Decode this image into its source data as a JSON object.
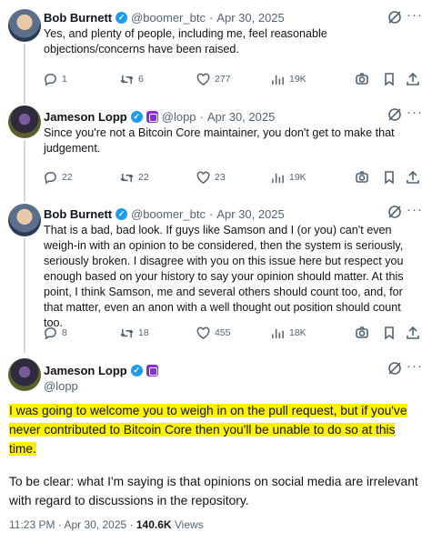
{
  "replies": [
    {
      "name": "Bob Burnett",
      "handle": "@boomer_btc",
      "date": "Apr 30, 2025",
      "text": "Yes, and plenty of people, including me, feel reasonable objections/concerns have been raised.",
      "replies_count": "1",
      "retweets": "6",
      "likes": "277",
      "views": "19K"
    },
    {
      "name": "Jameson Lopp",
      "handle": "@lopp",
      "date": "Apr 30, 2025",
      "text": "Since you're not a Bitcoin Core maintainer, you don't get to make that judgement.",
      "replies_count": "22",
      "retweets": "22",
      "likes": "23",
      "views": "19K"
    },
    {
      "name": "Bob Burnett",
      "handle": "@boomer_btc",
      "date": "Apr 30, 2025",
      "text": "That is a bad, bad look.  If guys like Samson and I (or you) can't even weigh-in with an opinion to be considered, then the system is seriously, seriously broken.  I disagree with you on this issue here but respect you enough based on your history to say your opinion should matter.  At this point, I think Samson, me and several others should count too, and, for that matter, even an anon with a well thought out position should count too.",
      "replies_count": "8",
      "retweets": "18",
      "likes": "455",
      "views": "18K"
    }
  ],
  "main": {
    "name": "Jameson Lopp",
    "handle": "@lopp",
    "highlighted_text": "I was going to welcome you to weigh in on the pull request, but if you've never contributed to Bitcoin Core then you'll be unable to do so at this time.",
    "text2": "To be clear: what I'm saying is that opinions on social media are irrelevant with regard to discussions in the repository.",
    "time": "11:23 PM · Apr 30, 2025 · ",
    "views_count": "140.6K",
    "views_label": " Views"
  },
  "colors": {
    "verified": "#1d9bf0",
    "highlight": "#fff200",
    "muted": "#536471"
  },
  "icons": [
    "verified-badge-icon",
    "affiliate-badge-icon",
    "grok-icon",
    "more-icon",
    "reply-icon",
    "retweet-icon",
    "like-icon",
    "views-icon",
    "share-icon",
    "bookmark-icon",
    "upload-icon"
  ]
}
